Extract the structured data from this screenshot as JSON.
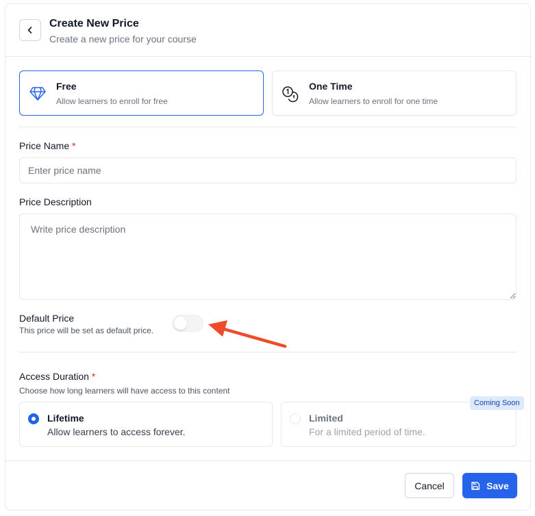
{
  "header": {
    "title": "Create New Price",
    "subtitle": "Create a new price for your course"
  },
  "price_types": [
    {
      "name": "Free",
      "description": "Allow learners to enroll for free",
      "icon": "diamond-icon",
      "selected": true
    },
    {
      "name": "One Time",
      "description": "Allow learners to enroll for one time",
      "icon": "coins-icon",
      "selected": false
    }
  ],
  "form": {
    "price_name": {
      "label": "Price Name",
      "required_mark": "*",
      "placeholder": "Enter price name",
      "value": ""
    },
    "price_description": {
      "label": "Price Description",
      "placeholder": "Write price description",
      "value": ""
    },
    "default_price": {
      "label": "Default Price",
      "hint": "This price will be set as default price.",
      "enabled": false
    },
    "access_duration": {
      "label": "Access Duration",
      "required_mark": "*",
      "hint": "Choose how long learners will have access to this content",
      "options": [
        {
          "name": "Lifetime",
          "description": "Allow learners to access forever.",
          "selected": true,
          "disabled": false
        },
        {
          "name": "Limited",
          "description": "For a limited period of time.",
          "selected": false,
          "disabled": true,
          "badge": "Coming Soon"
        }
      ]
    }
  },
  "footer": {
    "cancel_label": "Cancel",
    "save_label": "Save"
  },
  "colors": {
    "accent": "#2563eb",
    "required": "#dc2626",
    "annotation_arrow": "#ef4b2b",
    "badge_bg": "#dbeafe"
  }
}
